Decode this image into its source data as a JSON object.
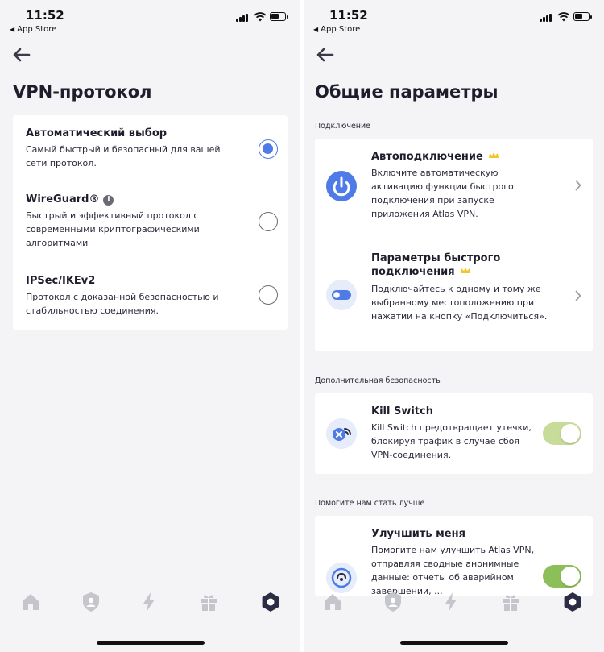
{
  "status_bar": {
    "time": "11:52",
    "back_app": "App Store"
  },
  "left_screen": {
    "title": "VPN-протокол",
    "options": [
      {
        "title": "Автоматический выбор",
        "desc": "Самый быстрый и безопасный для вашей сети протокол.",
        "selected": true
      },
      {
        "title": "WireGuard®",
        "desc": "Быстрый и эффективный протокол с современными криптографическими алгоритмами",
        "selected": false,
        "info_icon": "info-icon"
      },
      {
        "title": "IPSec/IKEv2",
        "desc": "Протокол с доказанной безопасностью и стабильностью соединения.",
        "selected": false
      }
    ]
  },
  "right_screen": {
    "title": "Общие параметры",
    "sections": {
      "connection": {
        "label": "Подключение",
        "items": [
          {
            "title": "Автоподключение",
            "desc": "Включите автоматическую активацию функции быстрого подключения при запуске приложения Atlas VPN.",
            "icon": "power-icon",
            "premium": true
          },
          {
            "title": "Параметры быстрого подключения",
            "desc": "Подключайтесь к одному и тому же выбранному местоположению при нажатии на кнопку «Подключиться».",
            "icon": "toggle-icon",
            "premium": true
          }
        ]
      },
      "security": {
        "label": "Дополнительная безопасность",
        "items": [
          {
            "title": "Kill Switch",
            "desc": "Kill Switch предотвращает утечки, блокируя трафик в случае сбоя VPN-соединения.",
            "icon": "kill-switch-icon",
            "enabled": true
          }
        ]
      },
      "improve": {
        "label": "Помогите нам стать лучше",
        "items": [
          {
            "title": "Улучшить меня",
            "desc": "Помогите нам улучшить Atlas VPN, отправляя сводные анонимные данные: отчеты об аварийном завершении, ...",
            "icon": "analytics-icon",
            "enabled": true
          }
        ]
      }
    }
  },
  "tabbar": [
    "home-icon",
    "shield-user-icon",
    "lightning-icon",
    "gift-icon",
    "settings-icon"
  ],
  "colors": {
    "accent": "#4f7be8",
    "toggle_kill": "#c8dc9a",
    "toggle_improve": "#8cbf5a",
    "crown": "#f3c623",
    "background": "#f4f4f6"
  }
}
